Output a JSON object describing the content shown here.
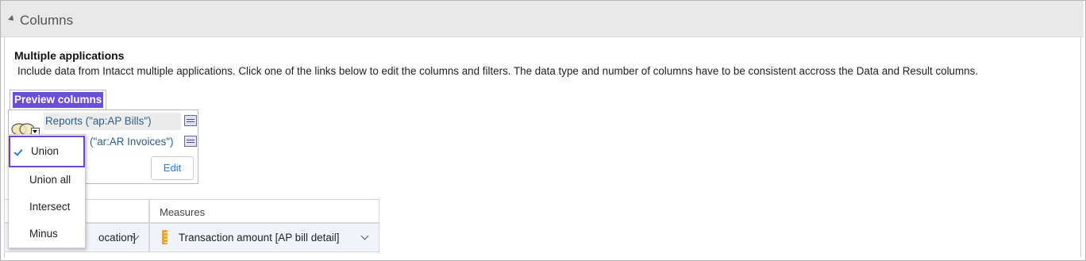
{
  "section": {
    "title": "Columns",
    "collapse_icon": "collapse-triangle-icon"
  },
  "multiple_apps": {
    "heading": "Multiple applications",
    "description": "Include data from Intacct multiple applications. Click one of the links below to edit the columns and filters. The data type and number of columns have to be consistent accross the Data and Result columns."
  },
  "preview": {
    "label": "Preview columns"
  },
  "applications": [
    {
      "label": "Reports (\"ap:AP Bills\")"
    },
    {
      "label": "(\"ar:AR Invoices\")"
    }
  ],
  "edit_button": "Edit",
  "set_operation_menu": {
    "selected": "Union",
    "options": [
      "Union",
      "Union all",
      "Intersect",
      "Minus"
    ]
  },
  "grid": {
    "header_measures": "Measures",
    "dimension_value": "ocation]",
    "measure_value": "Transaction amount [AP bill detail]"
  },
  "colors": {
    "accent_purple": "#6b47c9",
    "link_blue": "#2e5d8f",
    "header_bg": "#e9e9e9",
    "check_blue": "#2b7bd0"
  }
}
